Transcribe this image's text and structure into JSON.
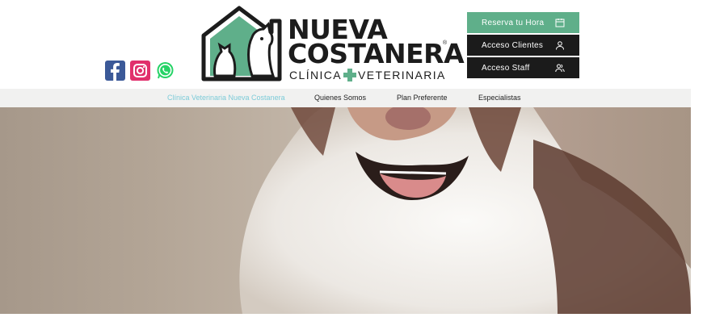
{
  "brand": {
    "name_line1": "NUEVA",
    "name_line2": "COSTANERA",
    "registered": "®",
    "subtitle_left": "CLÍNICA",
    "subtitle_right": "VETERINARIA",
    "accent_color": "#5faf8a"
  },
  "social": [
    {
      "name": "facebook-icon",
      "color": "#3b5998"
    },
    {
      "name": "instagram-icon",
      "color": "#e1306c"
    },
    {
      "name": "whatsapp-icon",
      "color": "#25d366"
    }
  ],
  "actions": {
    "reserve_label": "Reserva tu Hora",
    "clients_label": "Acceso Clientes",
    "staff_label": "Acceso Staff"
  },
  "nav": {
    "items": [
      {
        "label": "Clínica Veterinaria Nueva Costanera",
        "active": true
      },
      {
        "label": "Quienes Somos",
        "active": false
      },
      {
        "label": "Plan Preferente",
        "active": false
      },
      {
        "label": "Especialistas",
        "active": false
      }
    ]
  },
  "hero": {
    "image": "dog-photo"
  }
}
